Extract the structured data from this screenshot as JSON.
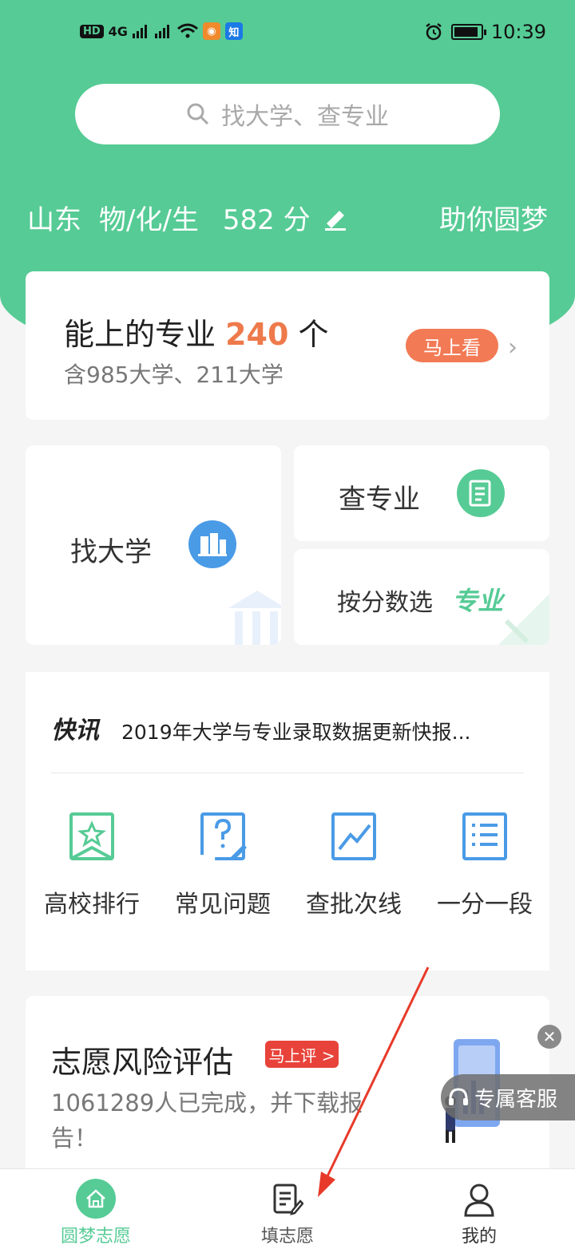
{
  "status_bar": {
    "network_badge": "HD",
    "network_type": "4G",
    "app_badge_zhihu": "知",
    "time": "10:39",
    "battery_level": 0.9
  },
  "search": {
    "placeholder": "找大学、查专业"
  },
  "profile": {
    "province": "山东",
    "subjects": "物/化/生",
    "score": "582 分",
    "slogan": "助你圆梦"
  },
  "majors_card": {
    "title_prefix": "能上的专业 ",
    "count": "240",
    "title_suffix": " 个",
    "subtitle": "含985大学、211大学",
    "button": "马上看"
  },
  "tiles": {
    "find_university": "找大学",
    "search_major": "查专业",
    "score_select": "按分数选",
    "score_select_highlight": "专业"
  },
  "news": {
    "logo": "快讯",
    "headline": "2019年大学与专业录取数据更新快报..."
  },
  "quick_links": [
    {
      "label": "高校排行",
      "icon": "ranking-icon"
    },
    {
      "label": "常见问题",
      "icon": "faq-icon"
    },
    {
      "label": "查批次线",
      "icon": "chart-icon"
    },
    {
      "label": "一分一段",
      "icon": "list-icon"
    }
  ],
  "risk_card": {
    "title": "志愿风险评估",
    "button": "马上评 >",
    "subtitle": "1061289人已完成，并下载报告！"
  },
  "customer_service": {
    "label": "专属客服"
  },
  "tab_bar": {
    "tabs": [
      {
        "label": "圆梦志愿",
        "icon": "home-icon",
        "active": true
      },
      {
        "label": "填志愿",
        "icon": "form-icon",
        "active": false
      },
      {
        "label": "我的",
        "icon": "user-icon",
        "active": false
      }
    ]
  },
  "colors": {
    "brand_green": "#56cb95",
    "accent_orange": "#ee7a4b",
    "alert_red": "#e8433a",
    "icon_blue": "#4a9be6"
  }
}
